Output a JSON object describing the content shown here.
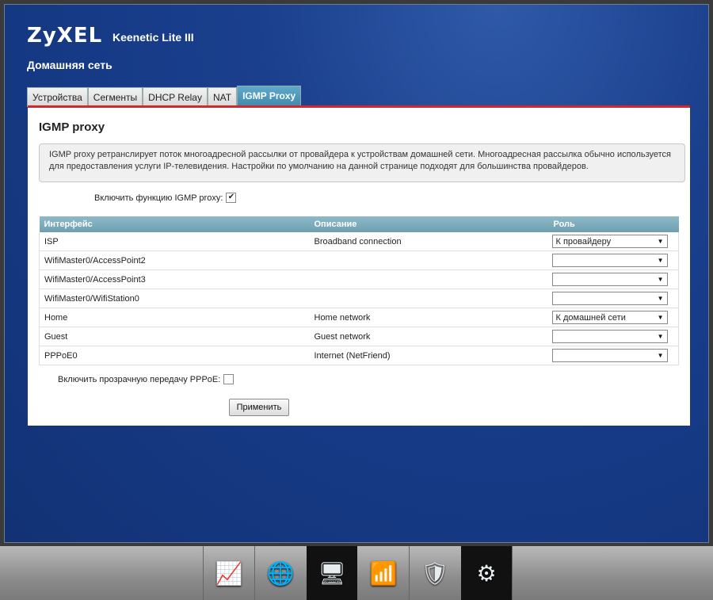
{
  "brand": {
    "logo": "ZyXEL",
    "model": "Keenetic Lite III"
  },
  "page_title": "Домашняя сеть",
  "tabs": [
    {
      "label": "Устройства",
      "active": false
    },
    {
      "label": "Сегменты",
      "active": false
    },
    {
      "label": "DHCP Relay",
      "active": false
    },
    {
      "label": "NAT",
      "active": false
    },
    {
      "label": "IGMP Proxy",
      "active": true
    }
  ],
  "panel": {
    "title": "IGMP proxy",
    "info": "IGMP proxy ретранслирует поток многоадресной рассылки от провайдера к устройствам домашней сети. Многоадресная рассылка обычно используется для предоставления услуги IP-телевидения. Настройки по умолчанию на данной странице подходят для большинства провайдеров.",
    "enable_label": "Включить функцию IGMP proxy:",
    "enable_checked": true,
    "table": {
      "headers": [
        "Интерфейс",
        "Описание",
        "Роль"
      ],
      "rows": [
        {
          "interface": "ISP",
          "description": "Broadband connection",
          "role": "К провайдеру"
        },
        {
          "interface": "WifiMaster0/AccessPoint2",
          "description": "",
          "role": ""
        },
        {
          "interface": "WifiMaster0/AccessPoint3",
          "description": "",
          "role": ""
        },
        {
          "interface": "WifiMaster0/WifiStation0",
          "description": "",
          "role": ""
        },
        {
          "interface": "Home",
          "description": "Home network",
          "role": "К домашней сети"
        },
        {
          "interface": "Guest",
          "description": "Guest network",
          "role": ""
        },
        {
          "interface": "PPPoE0",
          "description": "Internet (NetFriend)",
          "role": ""
        }
      ]
    },
    "pppoe_label": "Включить прозрачную передачу PPPoE:",
    "pppoe_checked": false,
    "apply_label": "Применить"
  },
  "dock": {
    "items": [
      {
        "name": "monitor-icon",
        "glyph": "📈",
        "active": false
      },
      {
        "name": "globe-icon",
        "glyph": "🌐",
        "active": false
      },
      {
        "name": "network-icon",
        "glyph": "🖥",
        "active": true
      },
      {
        "name": "signal-bars-icon",
        "glyph": "📶",
        "active": false
      },
      {
        "name": "shield-icon",
        "glyph": "🛡",
        "active": false
      },
      {
        "name": "gear-icon",
        "glyph": "⚙",
        "active": false
      }
    ]
  },
  "colors": {
    "accent_red": "#d2282e",
    "tab_active": "#3c8ab0",
    "background_blue": "#1a3f8c"
  }
}
